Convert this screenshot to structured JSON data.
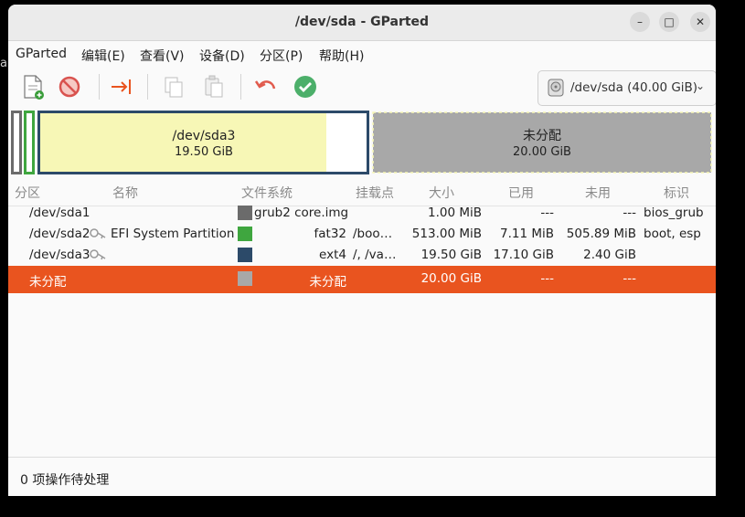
{
  "window": {
    "title": "/dev/sda - GParted"
  },
  "window_controls": {
    "minimize": "–",
    "maximize": "□",
    "close": "✕"
  },
  "menu": [
    "GParted",
    "编辑(E)",
    "查看(V)",
    "设备(D)",
    "分区(P)",
    "帮助(H)"
  ],
  "toolbar": {
    "icons": [
      "new-partition-icon",
      "delete-icon",
      "resize-move-icon",
      "copy-icon",
      "paste-icon",
      "undo-icon",
      "apply-icon"
    ],
    "device_label": "/dev/sda (40.00 GiB)"
  },
  "diskmap": {
    "sda3": {
      "name": "/dev/sda3",
      "size": "19.50 GiB",
      "used_fraction": 0.877
    },
    "unallocated": {
      "name": "未分配",
      "size": "20.00 GiB"
    }
  },
  "columns": [
    "分区",
    "名称",
    "文件系统",
    "挂载点",
    "大小",
    "已用",
    "未用",
    "标识"
  ],
  "rows": [
    {
      "partition": "/dev/sda1",
      "name": "",
      "fs": "grub2 core.img",
      "mount": "",
      "size": "1.00 MiB",
      "used": "---",
      "unused": "---",
      "flags": "bios_grub",
      "color": "#6b6b6b",
      "key": false
    },
    {
      "partition": "/dev/sda2",
      "name": "EFI System Partition",
      "fs": "fat32",
      "mount": "/boo…",
      "size": "513.00 MiB",
      "used": "7.11 MiB",
      "unused": "505.89 MiB",
      "flags": "boot, esp",
      "color": "#3fa63f",
      "key": true
    },
    {
      "partition": "/dev/sda3",
      "name": "",
      "fs": "ext4",
      "mount": "/, /va…",
      "size": "19.50 GiB",
      "used": "17.10 GiB",
      "unused": "2.40 GiB",
      "flags": "",
      "color": "#2c4a69",
      "key": true
    },
    {
      "partition": "未分配",
      "name": "",
      "fs": "未分配",
      "mount": "",
      "size": "20.00 GiB",
      "used": "---",
      "unused": "---",
      "flags": "",
      "color": "#a8a8a8",
      "key": false
    }
  ],
  "status": "0 项操作待处理",
  "colors": {
    "accent": "#e9541f",
    "ext4": "#2c4a69",
    "fat32": "#3fa63f",
    "unallocated": "#a8a8a8",
    "used_fill": "#f7f7b6"
  }
}
